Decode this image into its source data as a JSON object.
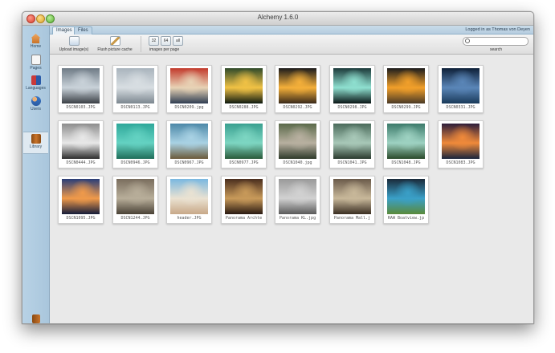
{
  "window": {
    "title": "Alchemy 1.6.0"
  },
  "sidebar": {
    "items": [
      {
        "label": "Home",
        "icon": "home-icon",
        "color": "#c8732a"
      },
      {
        "label": "Pages",
        "icon": "pages-icon",
        "color": "#d9d9d9"
      },
      {
        "label": "Languages",
        "icon": "languages-icon",
        "color": "#c93a3a"
      },
      {
        "label": "Users",
        "icon": "users-icon",
        "color": "#3a78c9"
      },
      {
        "label": "Library",
        "icon": "library-icon",
        "color": "#b5651d"
      }
    ],
    "logout_label": "logout"
  },
  "tabs": [
    "Images",
    "Files"
  ],
  "header": {
    "logged_in": "Logged in as Thomas von Deyen"
  },
  "toolbar": {
    "upload_label": "Upload image(s)",
    "flush_label": "Flush picture cache",
    "per_page_options": [
      "32",
      "64",
      "all"
    ],
    "per_page_label": "images per page",
    "search_placeholder": "",
    "search_label": "search"
  },
  "images": [
    {
      "name": "DSCN0103.JPG",
      "colors": [
        "#6f7b86",
        "#c9d2d9",
        "#3a3f45"
      ]
    },
    {
      "name": "DSCN0113.JPG",
      "colors": [
        "#a9b4bd",
        "#d8dee2",
        "#7c8790"
      ]
    },
    {
      "name": "DSCN0209.jpg",
      "colors": [
        "#c23a2c",
        "#e8d3b6",
        "#2f3d52"
      ]
    },
    {
      "name": "DSCN0288.JPG",
      "colors": [
        "#2f4a2a",
        "#f1c245",
        "#0e1a10"
      ]
    },
    {
      "name": "DSCN0292.JPG",
      "colors": [
        "#1b1b1b",
        "#f5b03a",
        "#3a2a1a"
      ]
    },
    {
      "name": "DSCN0298.JPG",
      "colors": [
        "#1c3a3a",
        "#8fe0d0",
        "#0a1616"
      ]
    },
    {
      "name": "DSCN0299.JPG",
      "colors": [
        "#1c1c1c",
        "#f2a02a",
        "#4a3a26"
      ]
    },
    {
      "name": "DSCN0331.JPG",
      "colors": [
        "#0e2038",
        "#5a86b8",
        "#1a3a5a"
      ]
    },
    {
      "name": "DSCN0444.JPG",
      "colors": [
        "#8d8d8d",
        "#e8e8e8",
        "#2c2c2c"
      ]
    },
    {
      "name": "DSCN0946.JPG",
      "colors": [
        "#2fa89a",
        "#64d2c2",
        "#1f6e5a"
      ]
    },
    {
      "name": "DSCN0967.JPG",
      "colors": [
        "#4c88a8",
        "#a9d2e4",
        "#6b5a3a"
      ]
    },
    {
      "name": "DSCN0977.JPG",
      "colors": [
        "#3aa090",
        "#7dd6c2",
        "#2a5a3a"
      ]
    },
    {
      "name": "DSCN1040.jpg",
      "colors": [
        "#5a6a4a",
        "#b8b0a0",
        "#2e3a2a"
      ]
    },
    {
      "name": "DSCN1041.JPG",
      "colors": [
        "#4a6a5a",
        "#a8c8b8",
        "#2a3a2e"
      ]
    },
    {
      "name": "DSCN1048.JPG",
      "colors": [
        "#3c7a6a",
        "#9ed2c2",
        "#2a4a2a"
      ]
    },
    {
      "name": "DSCN1083.JPG",
      "colors": [
        "#2c1c3a",
        "#f08a3a",
        "#18243c"
      ]
    },
    {
      "name": "DSCN1095.JPG",
      "colors": [
        "#2a3e78",
        "#f09a4a",
        "#141c3a"
      ]
    },
    {
      "name": "DSCN1244.JPG",
      "colors": [
        "#7a6e5e",
        "#b8ae9a",
        "#4a4236"
      ]
    },
    {
      "name": "header.JPG",
      "colors": [
        "#7ab8e0",
        "#eae2d2",
        "#c8a888"
      ]
    },
    {
      "name": "Panorama Archte",
      "colors": [
        "#4a2e1e",
        "#c89a5a",
        "#2a1a12"
      ]
    },
    {
      "name": "Panorama KL.jpg",
      "colors": [
        "#9a9a9a",
        "#d2d2d2",
        "#5a5a5a"
      ]
    },
    {
      "name": "Panorama Mall.j",
      "colors": [
        "#6a5a4a",
        "#c8b89a",
        "#3a2e22"
      ]
    },
    {
      "name": "RAW Boatview.jp",
      "colors": [
        "#1a2a3a",
        "#3aa0c8",
        "#5a8a3a"
      ]
    }
  ]
}
